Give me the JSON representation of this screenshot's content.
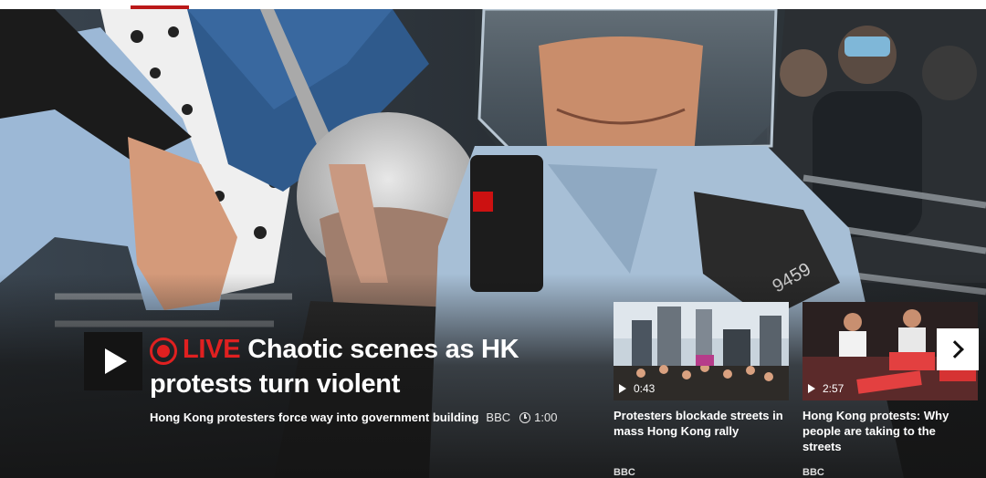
{
  "hero": {
    "live_label": "LIVE",
    "headline": "Chaotic scenes as HK protests turn violent",
    "summary": "Hong Kong protesters force way into government building",
    "source": "BBC",
    "duration": "1:00",
    "badge_number": "9459"
  },
  "related": [
    {
      "duration": "0:43",
      "title": "Protesters blockade streets in mass Hong Kong rally",
      "source": "BBC"
    },
    {
      "duration": "2:57",
      "title": "Hong Kong protests: Why people are taking to the streets",
      "source": "BBC"
    }
  ],
  "colors": {
    "live_red": "#e02020",
    "tab_indicator": "#bb1919",
    "background": "#1a1a1a"
  },
  "icons": {
    "play": "play-icon",
    "live": "live-icon",
    "clock": "clock-icon",
    "next": "chevron-right-icon"
  }
}
